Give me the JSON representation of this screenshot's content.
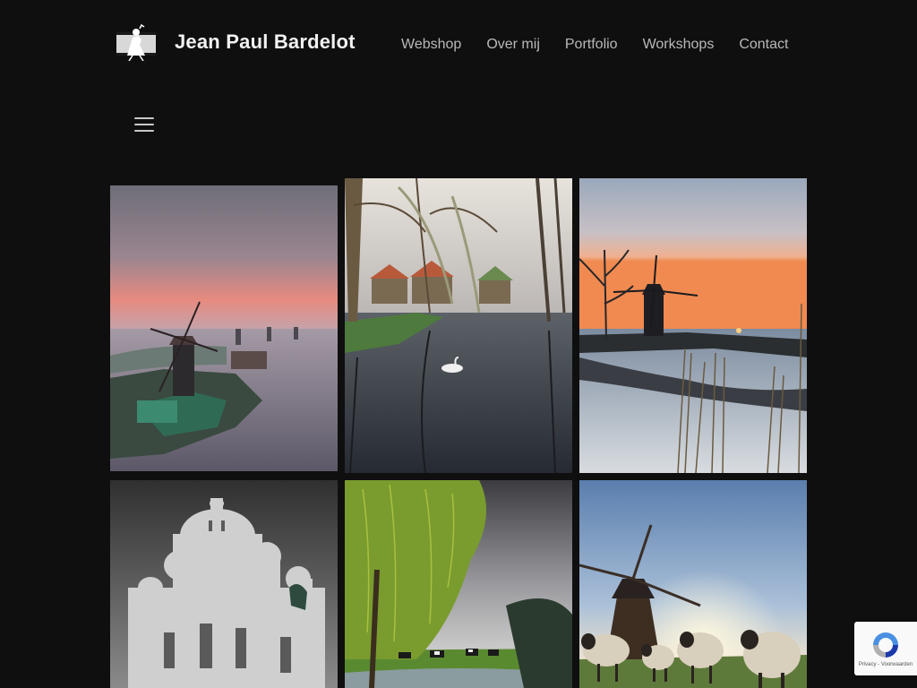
{
  "header": {
    "site_title": "Jean Paul Bardelot",
    "logo_icon": "photographer-camera-logo"
  },
  "nav": {
    "items": [
      {
        "label": "Webshop"
      },
      {
        "label": "Over mij"
      },
      {
        "label": "Portfolio"
      },
      {
        "label": "Workshops"
      },
      {
        "label": "Contact"
      }
    ]
  },
  "menu_toggle": {
    "icon": "hamburger-menu-icon"
  },
  "gallery": {
    "photos": [
      {
        "subject": "windmill-at-pink-sunrise"
      },
      {
        "subject": "swan-in-village-canal"
      },
      {
        "subject": "windmill-sunset-frozen-river"
      },
      {
        "subject": "sacre-coeur-basilica"
      },
      {
        "subject": "willow-and-cows-by-pond"
      },
      {
        "subject": "sheep-and-windmill-at-sunrise"
      }
    ]
  },
  "recaptcha": {
    "privacy_label": "Privacy",
    "separator": " - ",
    "terms_label": "Voorwaarden"
  },
  "colors": {
    "background": "#0f0f0f",
    "title": "#f2f2f2",
    "nav_text": "#b9b9b9"
  }
}
